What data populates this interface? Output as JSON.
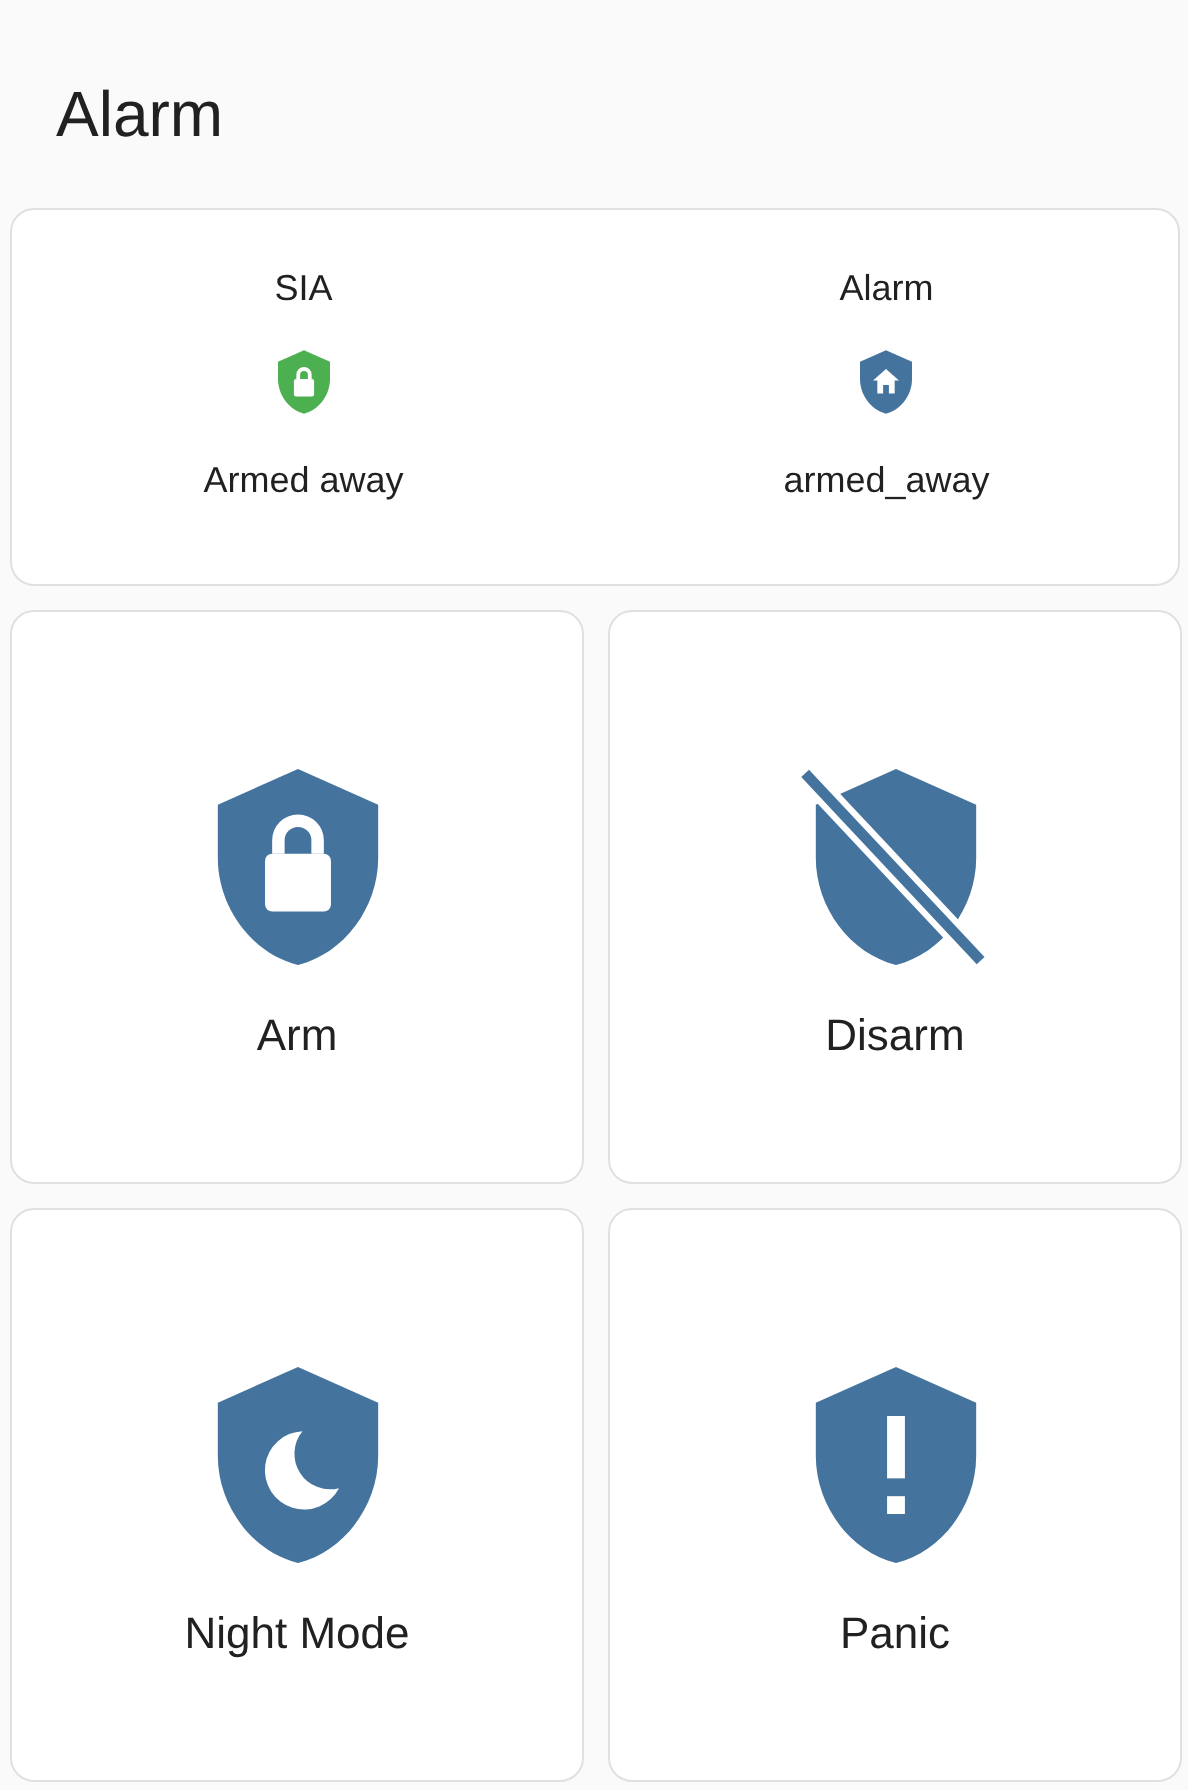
{
  "title": "Alarm",
  "entities": [
    {
      "name": "SIA",
      "kind": "lock",
      "color": "#4caf50",
      "state": "Armed away"
    },
    {
      "name": "Alarm",
      "kind": "home",
      "color": "#44739e",
      "state": "armed_away"
    }
  ],
  "buttons": [
    {
      "label": "Arm",
      "kind": "lock"
    },
    {
      "label": "Disarm",
      "kind": "off"
    },
    {
      "label": "Night Mode",
      "kind": "moon"
    },
    {
      "label": "Panic",
      "kind": "alert"
    }
  ]
}
